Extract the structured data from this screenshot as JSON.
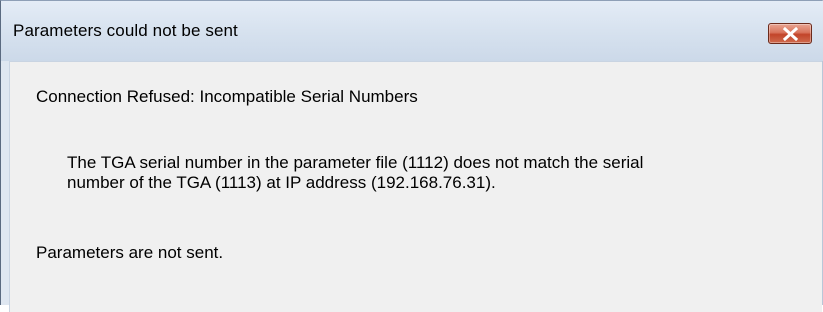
{
  "dialog": {
    "title": "Parameters could not be sent",
    "close_icon": "close-x-icon",
    "heading": "Connection Refused:  Incompatible Serial Numbers",
    "detail_line1": "The TGA serial number in the parameter file (1112) does not match the serial",
    "detail_line2": "number of the TGA (1113) at IP address (192.168.76.31).",
    "footer": "Parameters are not sent."
  },
  "colors": {
    "titlebar": "#d7e2ef",
    "body": "#f0f0f0",
    "close_button": "#c2442a"
  }
}
